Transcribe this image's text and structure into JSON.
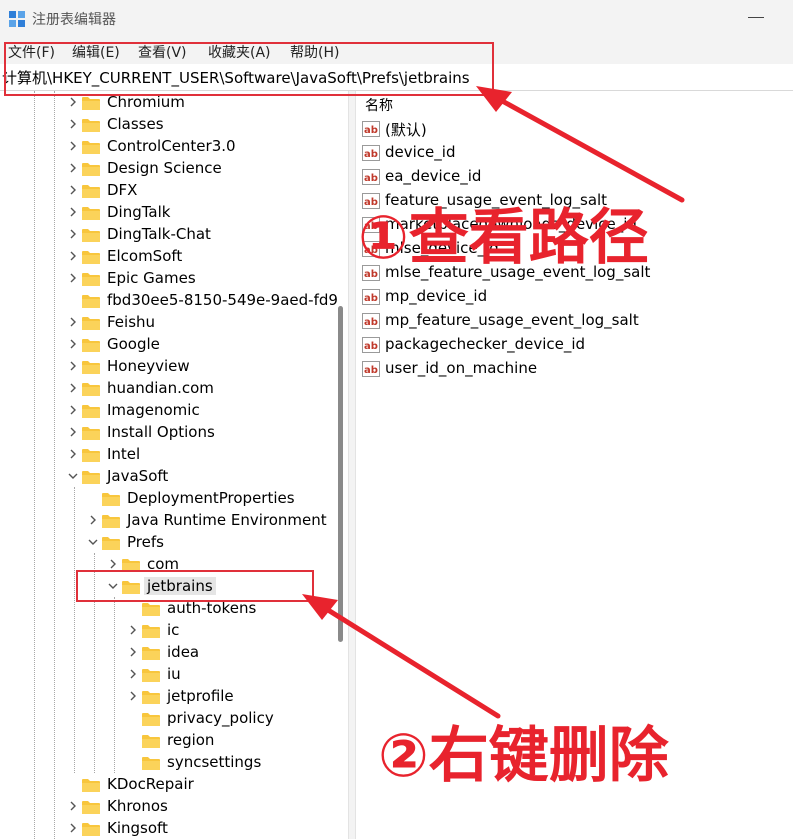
{
  "window": {
    "title": "注册表编辑器",
    "icon": "registry-editor-icon"
  },
  "menu": [
    "文件(F)",
    "编辑(E)",
    "查看(V)",
    "收藏夹(A)",
    "帮助(H)"
  ],
  "address": "计算机\\HKEY_CURRENT_USER\\Software\\JavaSoft\\Prefs\\jetbrains",
  "tree": [
    {
      "label": "Chromium",
      "depth": 0,
      "chevron": "right"
    },
    {
      "label": "Classes",
      "depth": 0,
      "chevron": "right"
    },
    {
      "label": "ControlCenter3.0",
      "depth": 0,
      "chevron": "right"
    },
    {
      "label": "Design Science",
      "depth": 0,
      "chevron": "right"
    },
    {
      "label": "DFX",
      "depth": 0,
      "chevron": "right"
    },
    {
      "label": "DingTalk",
      "depth": 0,
      "chevron": "right"
    },
    {
      "label": "DingTalk-Chat",
      "depth": 0,
      "chevron": "right"
    },
    {
      "label": "ElcomSoft",
      "depth": 0,
      "chevron": "right"
    },
    {
      "label": "Epic Games",
      "depth": 0,
      "chevron": "right"
    },
    {
      "label": "fbd30ee5-8150-549e-9aed-fd9",
      "depth": 0,
      "chevron": "none"
    },
    {
      "label": "Feishu",
      "depth": 0,
      "chevron": "right"
    },
    {
      "label": "Google",
      "depth": 0,
      "chevron": "right"
    },
    {
      "label": "Honeyview",
      "depth": 0,
      "chevron": "right"
    },
    {
      "label": "huandian.com",
      "depth": 0,
      "chevron": "right"
    },
    {
      "label": "Imagenomic",
      "depth": 0,
      "chevron": "right"
    },
    {
      "label": "Install Options",
      "depth": 0,
      "chevron": "right"
    },
    {
      "label": "Intel",
      "depth": 0,
      "chevron": "right"
    },
    {
      "label": "JavaSoft",
      "depth": 0,
      "chevron": "down"
    },
    {
      "label": "DeploymentProperties",
      "depth": 1,
      "chevron": "none"
    },
    {
      "label": "Java Runtime Environment",
      "depth": 1,
      "chevron": "right"
    },
    {
      "label": "Prefs",
      "depth": 1,
      "chevron": "down"
    },
    {
      "label": "com",
      "depth": 2,
      "chevron": "right"
    },
    {
      "label": "jetbrains",
      "depth": 2,
      "chevron": "down",
      "selected": true
    },
    {
      "label": "auth-tokens",
      "depth": 3,
      "chevron": "none"
    },
    {
      "label": "ic",
      "depth": 3,
      "chevron": "right"
    },
    {
      "label": "idea",
      "depth": 3,
      "chevron": "right"
    },
    {
      "label": "iu",
      "depth": 3,
      "chevron": "right"
    },
    {
      "label": "jetprofile",
      "depth": 3,
      "chevron": "right"
    },
    {
      "label": "privacy_policy",
      "depth": 3,
      "chevron": "none"
    },
    {
      "label": "region",
      "depth": 3,
      "chevron": "none"
    },
    {
      "label": "syncsettings",
      "depth": 3,
      "chevron": "none"
    },
    {
      "label": "KDocRepair",
      "depth": 0,
      "chevron": "none"
    },
    {
      "label": "Khronos",
      "depth": 0,
      "chevron": "right"
    },
    {
      "label": "Kingsoft",
      "depth": 0,
      "chevron": "right"
    }
  ],
  "values": {
    "column_name": "名称",
    "items": [
      "(默认)",
      "device_id",
      "ea_device_id",
      "feature_usage_event_log_salt",
      "marketplacedownloads_device_id",
      "mlse_device_id",
      "mlse_feature_usage_event_log_salt",
      "mp_device_id",
      "mp_feature_usage_event_log_salt",
      "packagechecker_device_id",
      "user_id_on_machine"
    ]
  },
  "annotations": {
    "step1": "①查看路径",
    "step2": "②右键删除",
    "color": "#e8232d"
  },
  "colors": {
    "folder": "#f8c63d",
    "accent_red": "#e8232d",
    "selection": "#e5e5e5"
  }
}
